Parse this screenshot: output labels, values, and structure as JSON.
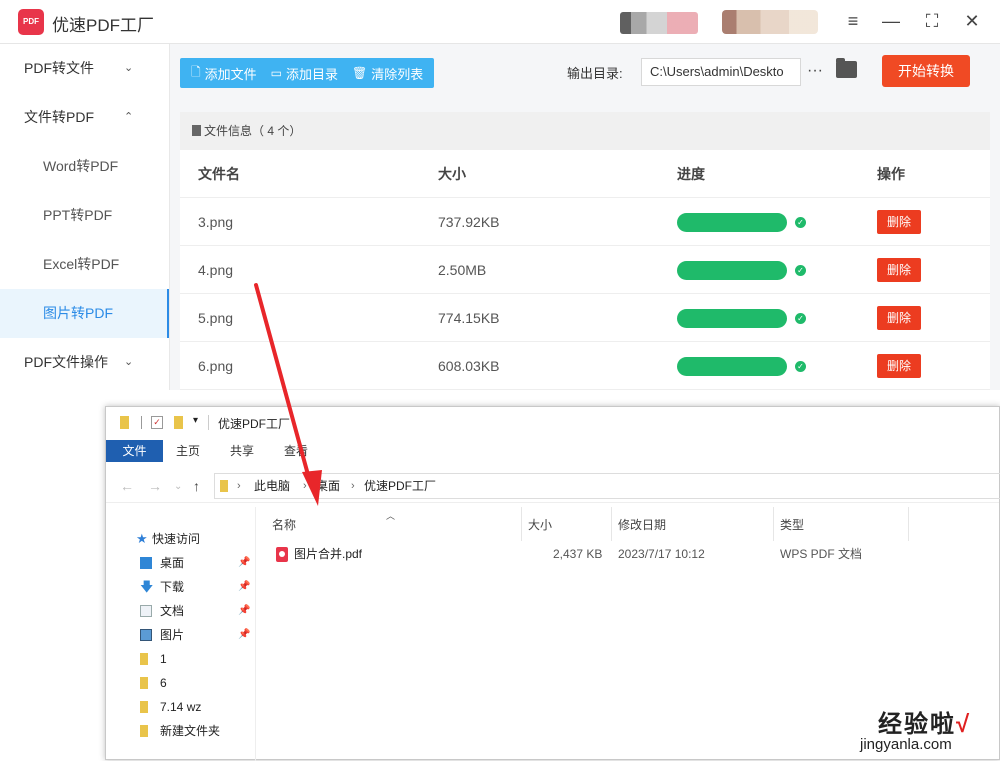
{
  "app": {
    "logo_text": "PDF",
    "title": "优速PDF工厂",
    "window_controls": [
      "≡",
      "—",
      "⛶",
      "✕"
    ]
  },
  "sidebar": {
    "items": [
      {
        "label": "PDF转文件",
        "chevron": "⌄"
      },
      {
        "label": "文件转PDF",
        "chevron": "⌃"
      },
      {
        "label": "Word转PDF"
      },
      {
        "label": "PPT转PDF"
      },
      {
        "label": "Excel转PDF"
      },
      {
        "label": "图片转PDF",
        "active": true
      },
      {
        "label": "PDF文件操作",
        "chevron": "⌄"
      }
    ]
  },
  "toolbar": {
    "add_file": "添加文件",
    "add_dir": "添加目录",
    "clear_list": "清除列表",
    "output_label": "输出目录:",
    "output_path": "C:\\Users\\admin\\Deskto",
    "more": "···",
    "start": "开始转换"
  },
  "file_table": {
    "info": "文件信息（ 4 个）",
    "headers": [
      "文件名",
      "大小",
      "进度",
      "操作"
    ],
    "rows": [
      {
        "name": "3.png",
        "size": "737.92KB",
        "progress": 1.0,
        "action": "删除"
      },
      {
        "name": "4.png",
        "size": "2.50MB",
        "progress": 1.0,
        "action": "删除"
      },
      {
        "name": "5.png",
        "size": "774.15KB",
        "progress": 1.0,
        "action": "删除"
      },
      {
        "name": "6.png",
        "size": "608.03KB",
        "progress": 1.0,
        "action": "删除"
      }
    ]
  },
  "explorer": {
    "title": "优速PDF工厂",
    "ribbon_tabs": [
      "文件",
      "主页",
      "共享",
      "查看"
    ],
    "address": [
      "此电脑",
      "桌面",
      "优速PDF工厂"
    ],
    "nav": {
      "quick_access": "快速访问",
      "items": [
        {
          "label": "桌面",
          "pinned": true
        },
        {
          "label": "下载",
          "pinned": true
        },
        {
          "label": "文档",
          "pinned": true
        },
        {
          "label": "图片",
          "pinned": true
        },
        {
          "label": "1"
        },
        {
          "label": "6"
        },
        {
          "label": "7.14 wz"
        },
        {
          "label": "新建文件夹"
        }
      ]
    },
    "columns": [
      "名称",
      "大小",
      "修改日期",
      "类型"
    ],
    "files": [
      {
        "name": "图片合并.pdf",
        "size": "2,437 KB",
        "modified": "2023/7/17 10:12",
        "type": "WPS PDF 文档"
      }
    ]
  },
  "watermark": {
    "line1": "经验啦",
    "check": "√",
    "line2": "jingyanla.com"
  },
  "colors": {
    "accent_blue": "#3fb3f2",
    "start_orange": "#f04a24",
    "progress_green": "#1fba6a",
    "delete_red": "#ec3c20",
    "arrow_red": "#e8262a"
  }
}
